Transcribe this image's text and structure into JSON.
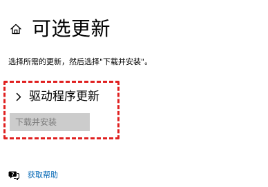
{
  "header": {
    "icon": "home-icon",
    "title": "可选更新"
  },
  "description": "选择所需的更新，然后选择\"下载并安装\"。",
  "driver_updates": {
    "icon": "chevron-right-icon",
    "title": "驱动程序更新",
    "expanded": false,
    "install_button": {
      "label": "下载并安装",
      "enabled": false
    }
  },
  "annotation": {
    "style": "dashed-red-box",
    "color": "#e02020"
  },
  "help": {
    "icon": "help-chat-icon",
    "label": "获取帮助",
    "color": "#0066b4"
  }
}
